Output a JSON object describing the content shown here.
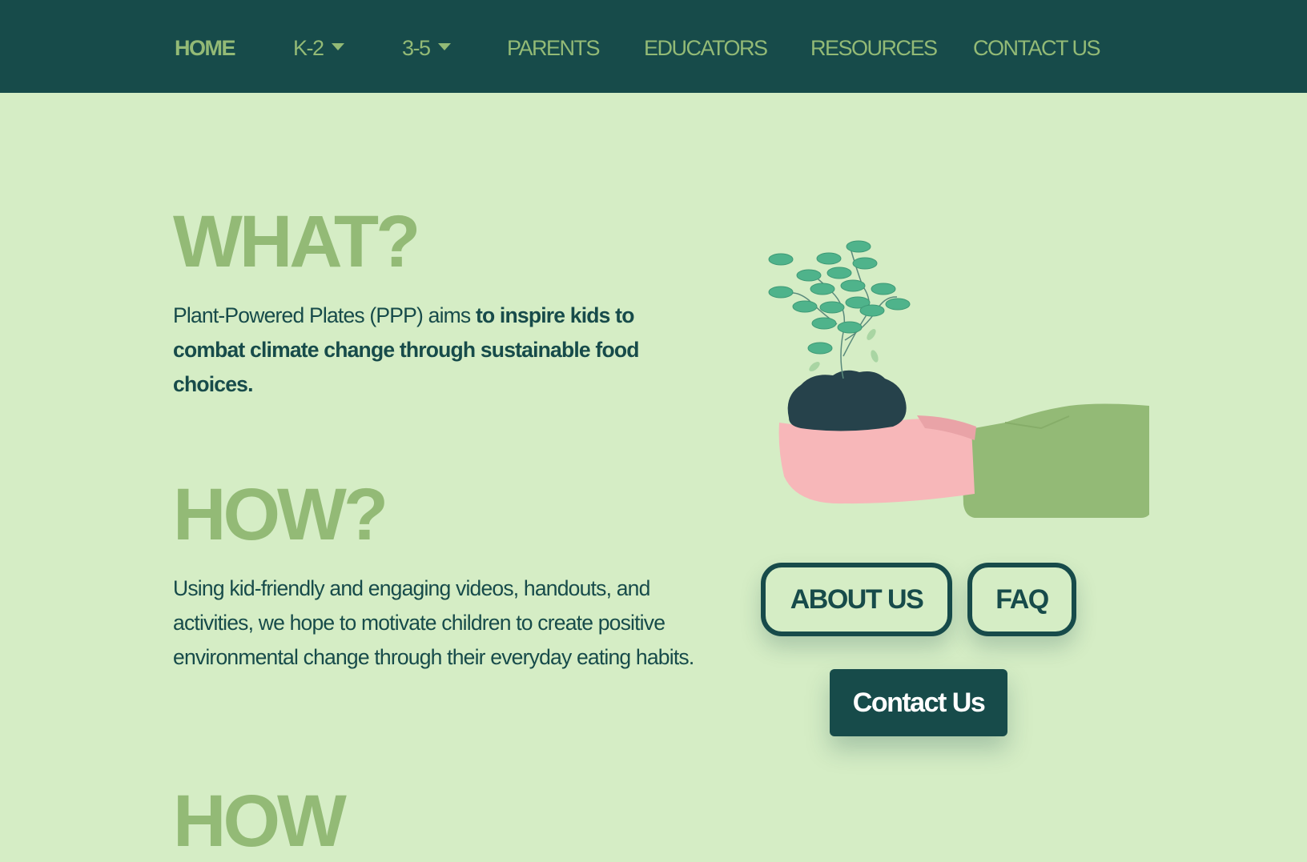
{
  "nav": {
    "home": "HOME",
    "k2": "K-2",
    "g35": "3-5",
    "parents": "PARENTS",
    "educators": "EDUCATORS",
    "resources": "RESOURCES",
    "contact": "CONTACT US"
  },
  "what": {
    "heading": "WHAT?",
    "text_plain": "Plant-Powered Plates (PPP) aims ",
    "text_bold": "to inspire kids to combat climate change through sustainable food choices."
  },
  "how": {
    "heading": "HOW?",
    "text": "Using kid-friendly and engaging videos, handouts, and activities, we hope to motivate children to create positive environmental change through their everyday eating habits."
  },
  "next_section": {
    "heading": "HOW"
  },
  "buttons": {
    "about": "ABOUT US",
    "faq": "FAQ",
    "contact": "Contact Us"
  },
  "colors": {
    "nav_bg": "#174b4a",
    "page_bg": "#d5edc5",
    "accent_green": "#93ba76",
    "text_dark": "#174b4a",
    "leaf": "#4fb38b",
    "hand": "#f7b7b9",
    "soil": "#26424b"
  },
  "icons": {
    "dropdown": "caret-down-icon",
    "illustration": "hand-holding-plant-illustration"
  }
}
